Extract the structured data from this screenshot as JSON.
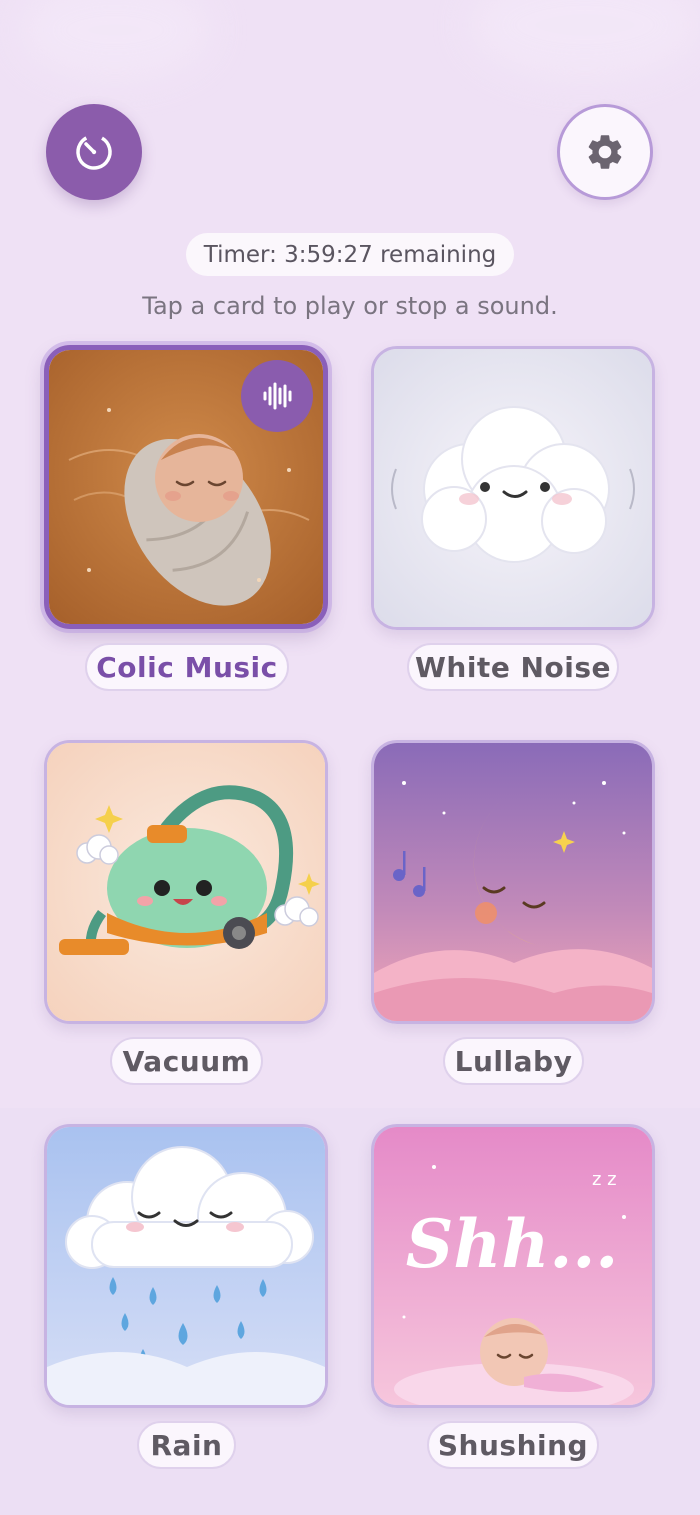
{
  "header": {
    "timer_icon": "timer-icon",
    "settings_icon": "gear-icon"
  },
  "timer": {
    "text": "Timer: 3:59:27 remaining"
  },
  "hint": "Tap a card to play or stop a sound.",
  "colors": {
    "accent": "#8a5cae",
    "background": "#efe1f5",
    "card_border": "#c7b3e2"
  },
  "sounds": [
    {
      "label": "Colic Music",
      "image": "swaddled-sleeping-baby",
      "playing": true,
      "indicator_icon": "sound-wave-icon"
    },
    {
      "label": "White Noise",
      "image": "smiling-cloud",
      "playing": false
    },
    {
      "label": "Vacuum",
      "image": "cute-vacuum-cleaner",
      "playing": false
    },
    {
      "label": "Lullaby",
      "image": "sleeping-crescent-moon",
      "playing": false
    },
    {
      "label": "Rain",
      "image": "rain-cloud",
      "playing": false
    },
    {
      "label": "Shushing",
      "image": "shh-sleeping-baby",
      "playing": false
    }
  ],
  "shushing_art_text": "Shh...",
  "shushing_art_zz": "z z"
}
